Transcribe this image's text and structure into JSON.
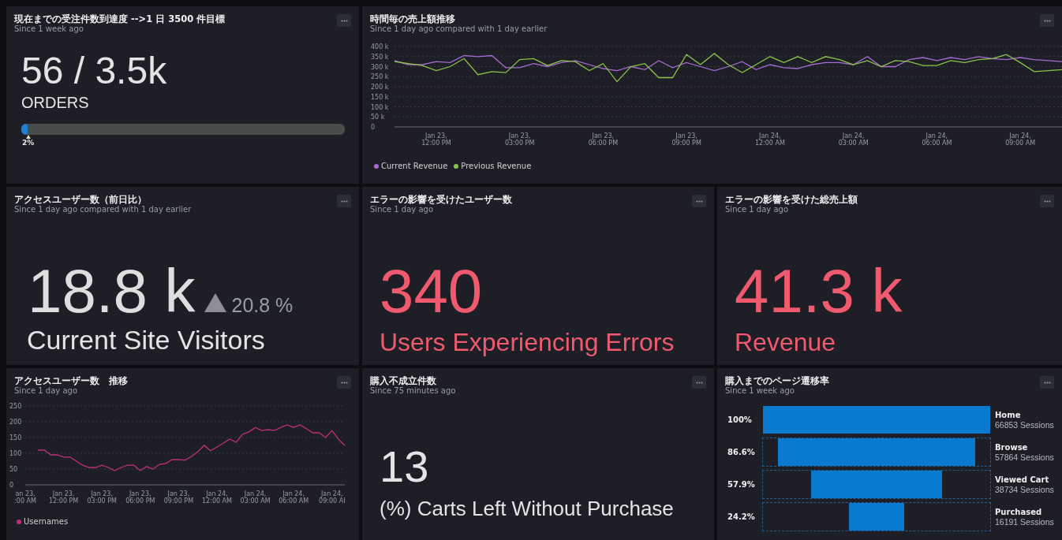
{
  "panels": [
    {
      "kind": "progress",
      "title": "現在までの受注件数到達度 -->1 日 3500 件目標",
      "subtitle": "Since 1 week ago",
      "value": "56 / 3.5k",
      "unit": "ORDERS",
      "level": 0.02,
      "marker": "2%"
    },
    {
      "kind": "line_chart",
      "title": "時間毎の売上額推移",
      "subtitle": "Since 1 day ago compared with 1 day earlier",
      "chart_data": {
        "type": "line",
        "categories": [
          null,
          null,
          null,
          "Jan 23,\n12:00 PM",
          null,
          null,
          null,
          null,
          null,
          "Jan 23,\n03:00 PM",
          null,
          null,
          null,
          null,
          null,
          "Jan 23,\n06:00 PM",
          null,
          null,
          null,
          null,
          null,
          "Jan 23,\n09:00 PM",
          null,
          null,
          null,
          null,
          null,
          "Jan 24,\n12:00 AM",
          null,
          null,
          null,
          null,
          null,
          "Jan 24,\n03:00 AM",
          null,
          null,
          null,
          null,
          null,
          "Jan 24,\n06:00 AM",
          null,
          null,
          null,
          null,
          null,
          "Jan 24,\n09:00 AM",
          null,
          null,
          null
        ],
        "series": [
          {
            "name": "Current Revenue",
            "color": "#a66bd3",
            "values": [
              330000,
              310000,
              310000,
              325000,
              320000,
              355000,
              350000,
              355000,
              295000,
              295000,
              315000,
              300000,
              320000,
              330000,
              310000,
              290000,
              280000,
              300000,
              285000,
              330000,
              295000,
              320000,
              300000,
              280000,
              300000,
              325000,
              285000,
              310000,
              295000,
              290000,
              310000,
              320000,
              320000,
              310000,
              350000,
              300000,
              300000,
              335000,
              345000,
              330000,
              345000,
              335000,
              350000,
              340000,
              335000,
              345000,
              335000,
              330000,
              325000
            ]
          },
          {
            "name": "Previous Revenue",
            "color": "#8bc34a",
            "values": [
              325000,
              315000,
              305000,
              280000,
              300000,
              340000,
              260000,
              275000,
              270000,
              335000,
              340000,
              305000,
              330000,
              325000,
              280000,
              315000,
              225000,
              300000,
              315000,
              245000,
              245000,
              360000,
              310000,
              365000,
              310000,
              270000,
              310000,
              350000,
              320000,
              350000,
              320000,
              350000,
              335000,
              310000,
              330000,
              300000,
              330000,
              325000,
              305000,
              305000,
              330000,
              320000,
              335000,
              340000,
              360000,
              320000,
              275000,
              280000,
              285000
            ]
          }
        ],
        "ylim": [
          0,
          400000
        ],
        "grid": true,
        "yticks": [
          {
            "value": 0,
            "label": "0"
          },
          {
            "value": 50000,
            "label": "50 k"
          },
          {
            "value": 100000,
            "label": "100 k"
          },
          {
            "value": 150000,
            "label": "150 k"
          },
          {
            "value": 200000,
            "label": "200 k"
          },
          {
            "value": 250000,
            "label": "250 k"
          },
          {
            "value": 300000,
            "label": "300 k"
          },
          {
            "value": 350000,
            "label": "350 k"
          },
          {
            "value": 400000,
            "label": "400 k"
          }
        ]
      }
    },
    {
      "kind": "comparison",
      "title": "アクセスユーザー数（前日比）",
      "subtitle": "Since 1 day ago compared with 1 day earlier",
      "value": "18.8 k",
      "change": "20.8 %",
      "label": "Current Site Visitors"
    },
    {
      "kind": "billboard",
      "title": "エラーの影響を受けたユーザー数",
      "subtitle": "Since 1 day ago",
      "value": "340",
      "label": "Users Experiencing Errors",
      "alert": true
    },
    {
      "kind": "billboard",
      "title": "エラーの影響を受けた総売上額",
      "subtitle": "Since 1 day ago",
      "value": "41.3 k",
      "label": "Revenue",
      "alert": true
    },
    {
      "kind": "line_chart",
      "title": "アクセスユーザー数　推移",
      "subtitle": "Since 1 day ago",
      "chart_data": {
        "type": "line",
        "categories": [
          "an 23,\n:00 AM",
          null,
          null,
          null,
          null,
          null,
          "Jan 23,\n12:00 PM",
          null,
          null,
          null,
          null,
          null,
          "Jan 23,\n03:00 PM",
          null,
          null,
          null,
          null,
          null,
          "Jan 23,\n06:00 PM",
          null,
          null,
          null,
          null,
          null,
          "Jan 23,\n09:00 PM",
          null,
          null,
          null,
          null,
          null,
          "Jan 24,\n12:00 AM",
          null,
          null,
          null,
          null,
          null,
          "Jan 24,\n03:00 AM",
          null,
          null,
          null,
          null,
          null,
          "Jan 24,\n06:00 AM",
          null,
          null,
          null,
          null,
          null,
          "Jan 24,\n09:00 AI",
          null,
          null
        ],
        "series": [
          {
            "name": "Usernames",
            "color": "#c0307a",
            "values": [
              null,
              null,
              110,
              110,
              95,
              95,
              88,
              88,
              75,
              62,
              55,
              55,
              62,
              55,
              45,
              55,
              62,
              62,
              45,
              58,
              50,
              65,
              68,
              80,
              80,
              78,
              90,
              105,
              125,
              108,
              120,
              132,
              145,
              135,
              160,
              168,
              182,
              172,
              175,
              172,
              182,
              190,
              182,
              190,
              178,
              165,
              165,
              150,
              172,
              145,
              125
            ]
          }
        ],
        "ylim": [
          0,
          250
        ],
        "grid": true,
        "yticks": [
          0,
          50,
          100,
          150,
          200,
          250
        ]
      }
    },
    {
      "kind": "billboard",
      "title": "購入不成立件数",
      "subtitle": "Since 75 minutes ago",
      "value": "13",
      "label": "(%) Carts Left Without Purchase",
      "alert": false
    },
    {
      "kind": "funnel",
      "title": "購入までのページ遷移率",
      "subtitle": "Since 1 week ago",
      "stages": [
        {
          "percent": "100%",
          "name": "Home",
          "sessions": "66853 Sessions"
        },
        {
          "percent": "86.6%",
          "name": "Browse",
          "sessions": "57864 Sessions"
        },
        {
          "percent": "57.9%",
          "name": "Viewed Cart",
          "sessions": "38734 Sessions"
        },
        {
          "percent": "24.2%",
          "name": "Purchased",
          "sessions": "16191 Sessions"
        }
      ]
    }
  ]
}
